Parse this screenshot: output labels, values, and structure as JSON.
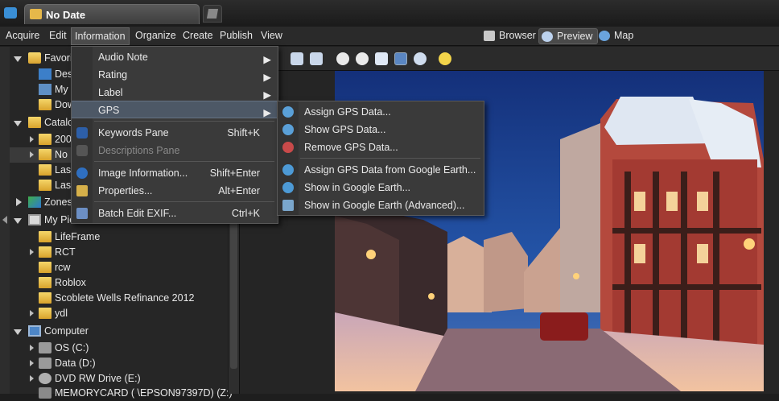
{
  "title_tab": "No Date",
  "menubar": {
    "items": [
      "Acquire",
      "Edit",
      "Information",
      "Organize",
      "Create",
      "Publish",
      "View"
    ],
    "views": [
      "Browser",
      "Preview",
      "Map"
    ]
  },
  "tree": {
    "favorites": "Favorites",
    "fav_children": [
      "Desktop",
      "My Documents",
      "Downloads"
    ],
    "catalog": "Catalog",
    "catalog_children": [
      "2004",
      "No Date",
      "Last",
      "Last"
    ],
    "zones": "Zones",
    "my_pictures": "My Pictures",
    "pictures_children": [
      "LifeFrame",
      "RCT",
      "rcw",
      "Roblox",
      "Scoblete Wells Refinance 2012",
      "ydl"
    ],
    "computer": "Computer",
    "drives": [
      "OS (C:)",
      "Data (D:)",
      "DVD RW Drive (E:)",
      "MEMORYCARD ( \\EPSON97397D) (Z:)"
    ]
  },
  "info_menu": {
    "items": [
      {
        "label": "Audio Note",
        "shortcut": "",
        "submenu": true,
        "disabled": false
      },
      {
        "label": "Rating",
        "shortcut": "",
        "submenu": true,
        "disabled": false
      },
      {
        "label": "Label",
        "shortcut": "",
        "submenu": true,
        "disabled": false
      },
      {
        "label": "GPS",
        "shortcut": "",
        "submenu": true,
        "disabled": false,
        "highlighted": true
      },
      {
        "label": "Keywords Pane",
        "shortcut": "Shift+K",
        "submenu": false,
        "disabled": false
      },
      {
        "label": "Descriptions Pane",
        "shortcut": "",
        "submenu": false,
        "disabled": true
      },
      {
        "label": "Image Information...",
        "shortcut": "Shift+Enter",
        "submenu": false,
        "disabled": false
      },
      {
        "label": "Properties...",
        "shortcut": "Alt+Enter",
        "submenu": false,
        "disabled": false
      },
      {
        "label": "Batch Edit EXIF...",
        "shortcut": "Ctrl+K",
        "submenu": false,
        "disabled": false
      }
    ]
  },
  "gps_menu": {
    "items": [
      "Assign GPS Data...",
      "Show GPS Data...",
      "Remove GPS Data...",
      "Assign GPS Data from Google Earth...",
      "Show in Google Earth...",
      "Show in Google Earth (Advanced)..."
    ]
  },
  "colors": {
    "accent": "#4d5866",
    "background": "#1e1e1e",
    "menu": "#3a3a3a",
    "folder": "#e6b84a"
  }
}
